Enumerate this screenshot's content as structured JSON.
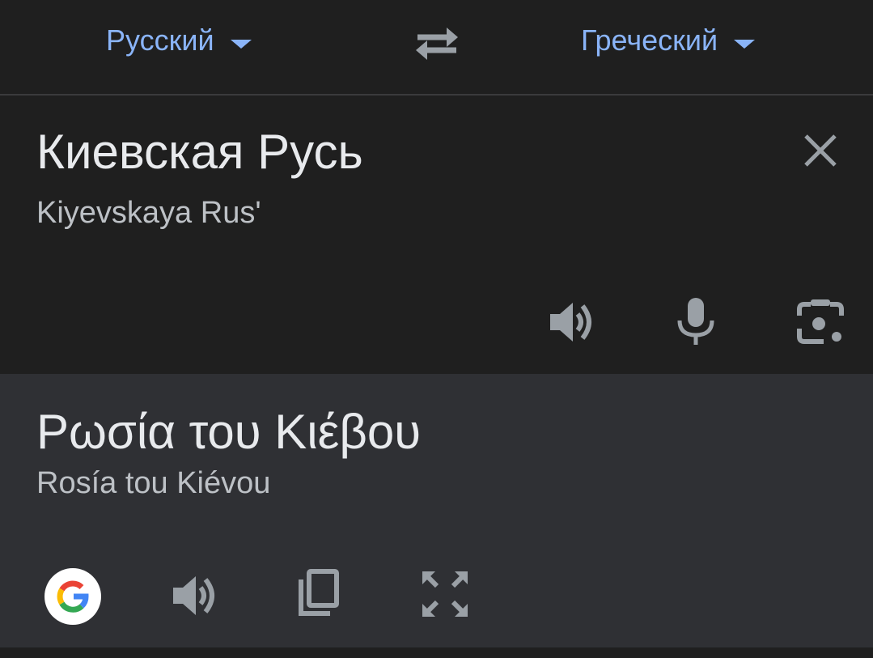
{
  "lang_bar": {
    "source_language": "Русский",
    "target_language": "Греческий"
  },
  "source": {
    "text": "Киевская Русь",
    "transliteration": "Kiyevskaya Rus'"
  },
  "target": {
    "text": "Ρωσία του Κιέβου",
    "transliteration": "Rosía tou Kiévou"
  },
  "icons": {
    "swap": "swap-arrows-icon",
    "clear": "close-icon",
    "source_listen": "speaker-icon",
    "mic": "microphone-icon",
    "camera": "camera-lens-icon",
    "google": "google-logo-icon",
    "target_listen": "speaker-icon",
    "copy": "copy-icon",
    "fullscreen": "fullscreen-icon"
  },
  "colors": {
    "accent": "#8ab4f8",
    "background": "#1f1f1f",
    "target_panel": "#2f3034",
    "icon": "#9aa0a6",
    "text_primary": "#e8eaed",
    "text_secondary": "#bdc1c6"
  }
}
